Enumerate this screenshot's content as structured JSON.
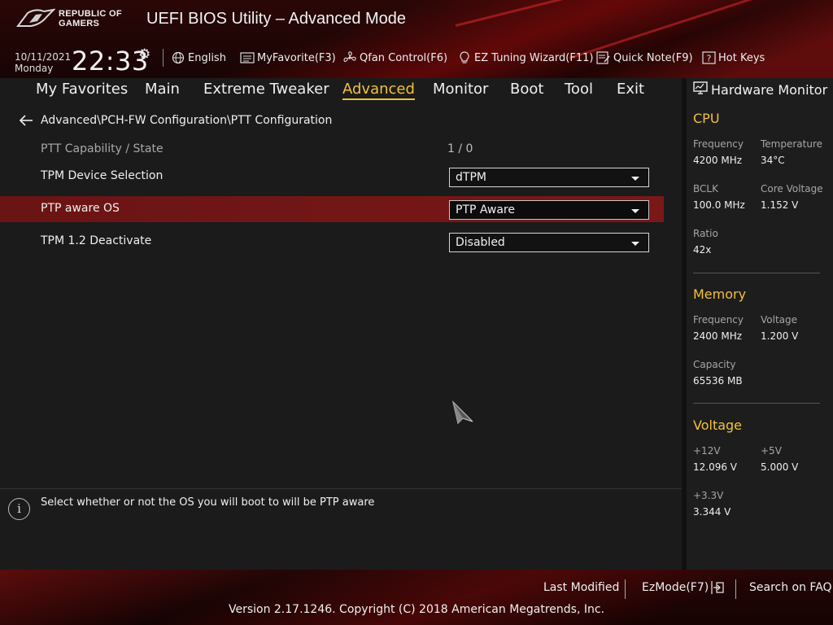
{
  "header": {
    "brand_line1": "REPUBLIC OF",
    "brand_line2": "GAMERS",
    "title": "UEFI BIOS Utility – Advanced Mode",
    "date": "10/11/2021",
    "day": "Monday",
    "time": "22:33",
    "buttons": {
      "language": "English",
      "favorite": "MyFavorite(F3)",
      "qfan": "Qfan Control(F6)",
      "ez_tuning": "EZ Tuning Wizard(F11)",
      "quick_note": "Quick Note(F9)",
      "hot_keys": "Hot Keys"
    }
  },
  "tabs": {
    "my_favorites": "My Favorites",
    "main": "Main",
    "extreme_tweaker": "Extreme Tweaker",
    "advanced": "Advanced",
    "monitor": "Monitor",
    "boot": "Boot",
    "tool": "Tool",
    "exit": "Exit",
    "active": "Advanced"
  },
  "main": {
    "breadcrumb": "Advanced\\PCH-FW Configuration\\PTT Configuration",
    "rows": [
      {
        "label": "PTT Capability / State",
        "value": "1 / 0"
      },
      {
        "label": "TPM Device Selection",
        "value": "dTPM"
      },
      {
        "label": "PTP aware OS",
        "value": "PTP Aware"
      },
      {
        "label": "TPM 1.2 Deactivate",
        "value": "Disabled"
      }
    ]
  },
  "help": {
    "text": "Select whether or not the OS you will boot to will be PTP aware"
  },
  "hw_monitor": {
    "title": "Hardware Monitor",
    "cpu": {
      "heading": "CPU",
      "frequency_label": "Frequency",
      "frequency": "4200 MHz",
      "temperature_label": "Temperature",
      "temperature": "34°C",
      "bclk_label": "BCLK",
      "bclk": "100.0 MHz",
      "core_voltage_label": "Core Voltage",
      "core_voltage": "1.152 V",
      "ratio_label": "Ratio",
      "ratio": "42x"
    },
    "memory": {
      "heading": "Memory",
      "frequency_label": "Frequency",
      "frequency": "2400 MHz",
      "voltage_label": "Voltage",
      "voltage": "1.200 V",
      "capacity_label": "Capacity",
      "capacity": "65536 MB"
    },
    "voltage": {
      "heading": "Voltage",
      "v12_label": "+12V",
      "v12": "12.096 V",
      "v5_label": "+5V",
      "v5": "5.000 V",
      "v33_label": "+3.3V",
      "v33": "3.344 V"
    }
  },
  "footer": {
    "last_modified": "Last Modified",
    "ez_mode": "EzMode(F7)",
    "search_faq": "Search on FAQ",
    "copyright": "Version 2.17.1246. Copyright (C) 2018 American Megatrends, Inc."
  },
  "colors": {
    "accent": "#f2c13a",
    "selected_row": "#7a1818",
    "background": "#1b1b1b"
  }
}
